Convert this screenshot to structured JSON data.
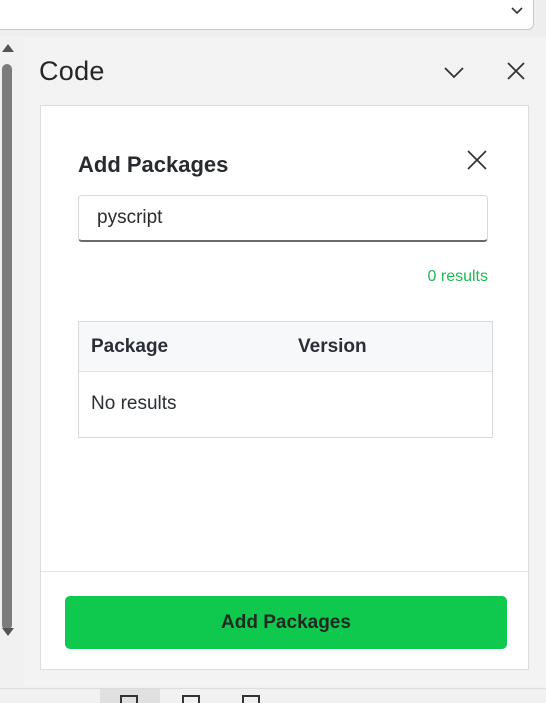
{
  "pane": {
    "title": "Code"
  },
  "dialog": {
    "title": "Add Packages",
    "search": {
      "value": "pyscript",
      "placeholder": ""
    },
    "results_count": "0 results",
    "table": {
      "columns": [
        "Package",
        "Version"
      ],
      "empty_text": "No results"
    },
    "add_button_label": "Add Packages"
  },
  "colors": {
    "accent_green": "#0fc94f",
    "results_green": "#1fb955"
  },
  "icons": [
    "chevron-down-icon",
    "close-icon",
    "scroll-up-arrow-icon",
    "scroll-down-arrow-icon",
    "grid-view-icon",
    "page-view-icon"
  ]
}
